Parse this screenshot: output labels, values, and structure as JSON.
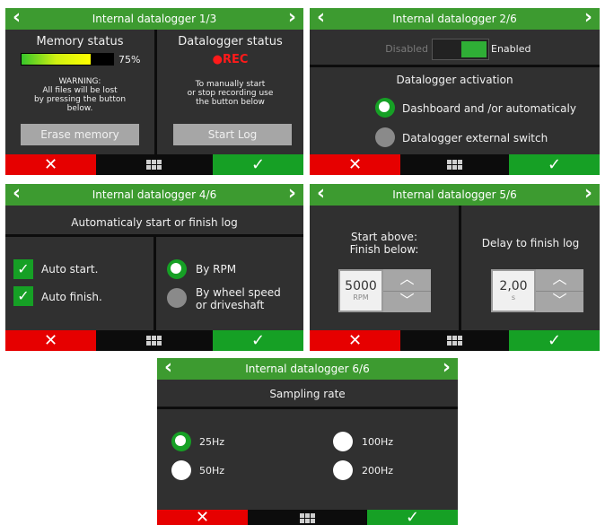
{
  "panel1": {
    "title": "Internal datalogger 1/3",
    "memory_status_title": "Memory status",
    "memory_percent_label": "75%",
    "memory_fill": 0.75,
    "datalogger_status_title": "Datalogger status",
    "rec_label": "●REC",
    "warning_text": "WARNING:\nAll files will be lost\nby pressing the button\nbelow.",
    "manual_text": "To manually start\nor stop recording use\nthe button below",
    "erase_button": "Erase memory",
    "start_log_button": "Start Log"
  },
  "panel2": {
    "title": "Internal datalogger 2/6",
    "disabled_label": "Disabled",
    "enabled_label": "Enabled",
    "section_title": "Datalogger activation",
    "option_1": "Dashboard and /or automaticaly",
    "option_2": "Datalogger external switch",
    "selected_option": 1
  },
  "panel4": {
    "title": "Internal datalogger 4/6",
    "section_title": "Automaticaly start or finish log",
    "auto_start": "Auto start.",
    "auto_finish": "Auto finish.",
    "by_rpm": "By RPM",
    "by_wheel": "By wheel speed\nor driveshaft"
  },
  "panel5": {
    "title": "Internal datalogger 5/6",
    "start_finish_label": "Start above:\nFinish below:",
    "delay_label": "Delay to finish log",
    "rpm_value": "5000",
    "rpm_unit": "RPM",
    "delay_value": "2,00",
    "delay_unit": "s"
  },
  "panel6": {
    "title": "Internal datalogger 6/6",
    "section_title": "Sampling rate",
    "opt_25": "25Hz",
    "opt_50": "50Hz",
    "opt_100": "100Hz",
    "opt_200": "200Hz",
    "selected": "25Hz"
  },
  "icons": {
    "prev": "‹",
    "next": "›",
    "cancel": "✕",
    "confirm": "✓",
    "up": "︿",
    "down": "﹀"
  },
  "colors": {
    "header_green": "#3d9b30",
    "cancel_red": "#e60000",
    "confirm_green": "#16a025",
    "panel_bg": "#303030"
  }
}
